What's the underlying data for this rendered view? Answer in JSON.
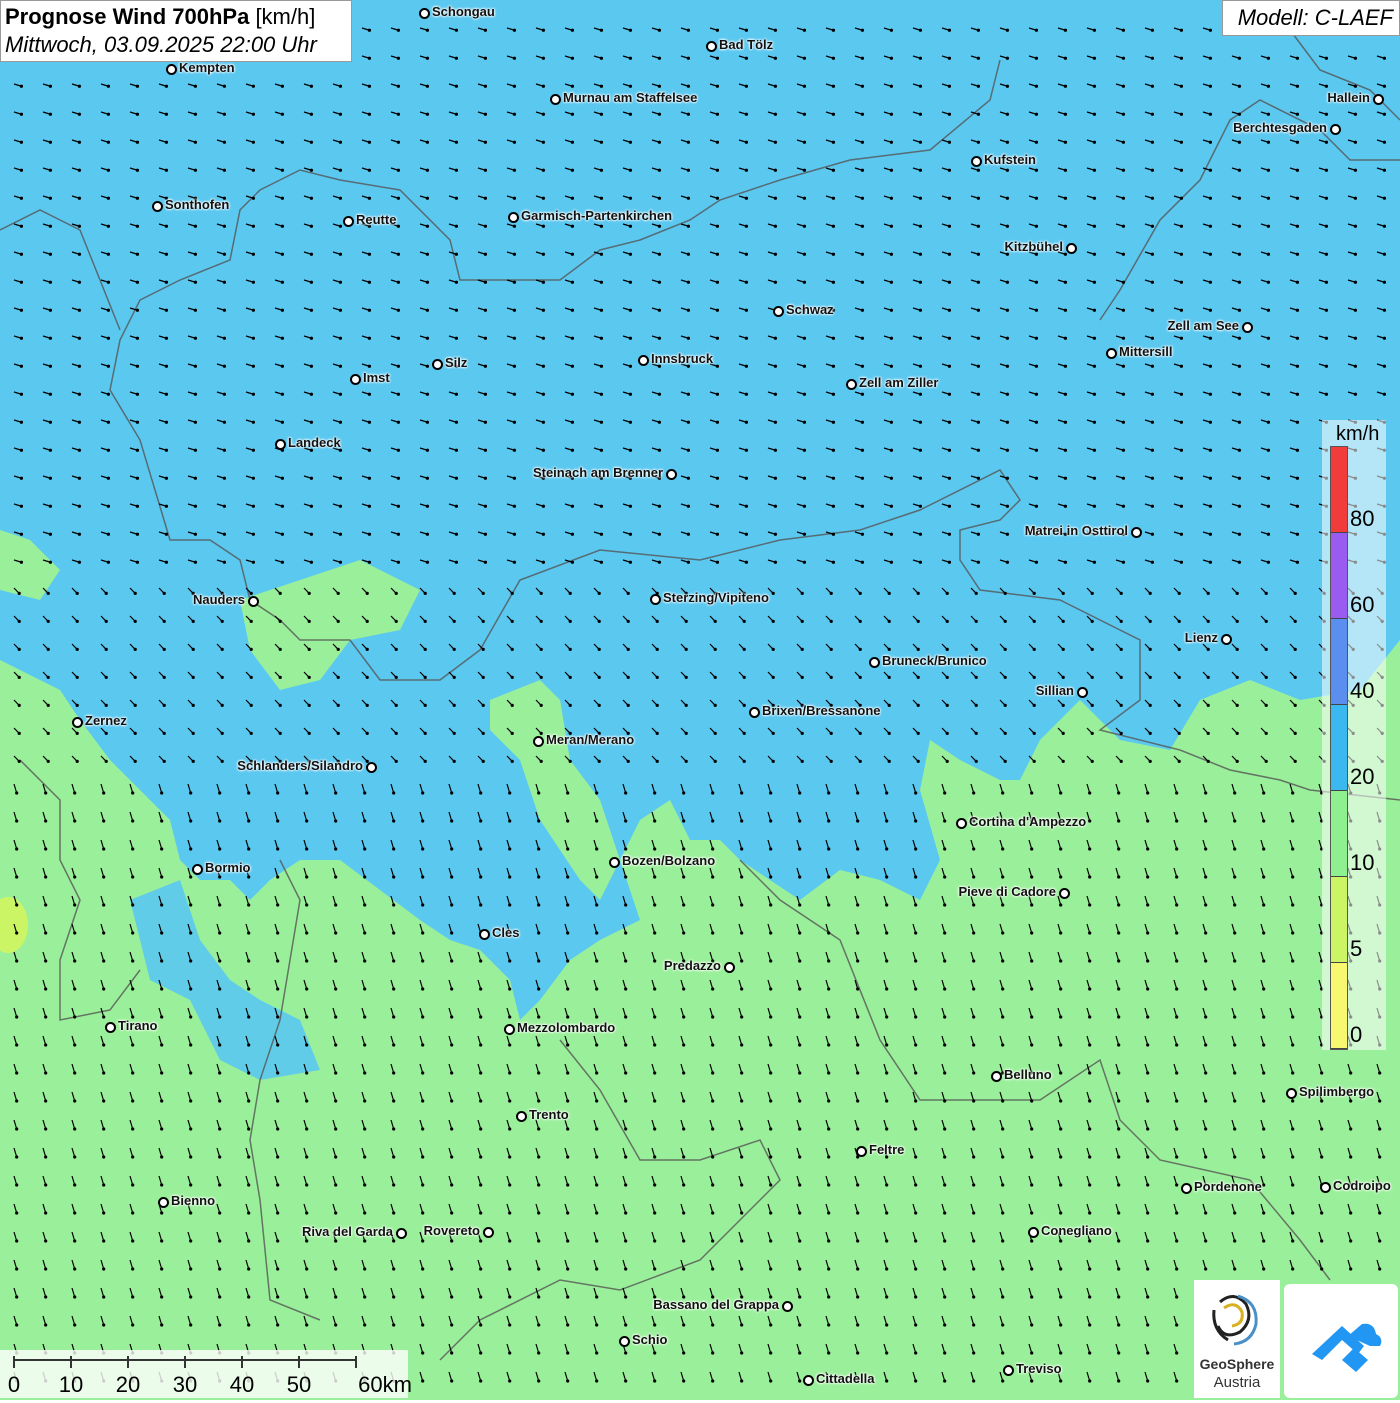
{
  "title": {
    "main": "Prognose Wind 700hPa",
    "unit": "[km/h]",
    "datetime": "Mittwoch, 03.09.2025 22:00 Uhr"
  },
  "model": "Modell: C-LAEF",
  "colors": {
    "blue_zone": "#5bc8f0",
    "green_zone": "#9af09a",
    "border": "#555555",
    "arrow": "#000000"
  },
  "legend": {
    "unit": "km/h",
    "ticks": [
      "80",
      "60",
      "40",
      "20",
      "10",
      "5",
      "0"
    ],
    "colors_top_to_bottom": [
      "#f23b3b",
      "#9a5bf0",
      "#5a8ff0",
      "#3cb8f0",
      "#8ef08e",
      "#ccf566",
      "#f8f870"
    ]
  },
  "scalebar": {
    "labels": [
      "0",
      "10",
      "20",
      "30",
      "40",
      "50",
      "60km"
    ]
  },
  "logos": {
    "geosphere_line1": "GeoSphere",
    "geosphere_line2": "Austria",
    "geosphere_icon": "geosphere-logo",
    "app_icon": "wetter-app-logo"
  },
  "cities": [
    {
      "name": "Schongau"
    },
    {
      "name": "Bad Tölz"
    },
    {
      "name": "Kempten"
    },
    {
      "name": "Murnau am Staffelsee"
    },
    {
      "name": "Hallein"
    },
    {
      "name": "Berchtesgaden"
    },
    {
      "name": "Kufstein"
    },
    {
      "name": "Sonthofen"
    },
    {
      "name": "Reutte"
    },
    {
      "name": "Garmisch-Partenkirchen"
    },
    {
      "name": "Kitzbühel"
    },
    {
      "name": "Schwaz"
    },
    {
      "name": "Zell am See"
    },
    {
      "name": "Innsbruck"
    },
    {
      "name": "Mittersill"
    },
    {
      "name": "Silz"
    },
    {
      "name": "Imst"
    },
    {
      "name": "Zell am Ziller"
    },
    {
      "name": "Landeck"
    },
    {
      "name": "Steinach am Brenner"
    },
    {
      "name": "Matrei in Osttirol"
    },
    {
      "name": "Nauders"
    },
    {
      "name": "Sterzing/Vipiteno"
    },
    {
      "name": "Lienz"
    },
    {
      "name": "Bruneck/Brunico"
    },
    {
      "name": "Sillian"
    },
    {
      "name": "Zernez"
    },
    {
      "name": "Brixen/Bressanone"
    },
    {
      "name": "Meran/Merano"
    },
    {
      "name": "Schlanders/Silandro"
    },
    {
      "name": "Cortina d'Ampezzo"
    },
    {
      "name": "Bozen/Bolzano"
    },
    {
      "name": "Bormio"
    },
    {
      "name": "Pieve di Cadore"
    },
    {
      "name": "Cles"
    },
    {
      "name": "Predazzo"
    },
    {
      "name": "Tirano"
    },
    {
      "name": "Mezzolombardo"
    },
    {
      "name": "Belluno"
    },
    {
      "name": "Spilimbergo"
    },
    {
      "name": "Trento"
    },
    {
      "name": "Feltre"
    },
    {
      "name": "Pordenone"
    },
    {
      "name": "Codroipo"
    },
    {
      "name": "Bienno"
    },
    {
      "name": "Riva del Garda"
    },
    {
      "name": "Rovereto"
    },
    {
      "name": "Conegliano"
    },
    {
      "name": "Bassano del Grappa"
    },
    {
      "name": "Schio"
    },
    {
      "name": "Treviso"
    },
    {
      "name": "Cittadella"
    }
  ]
}
